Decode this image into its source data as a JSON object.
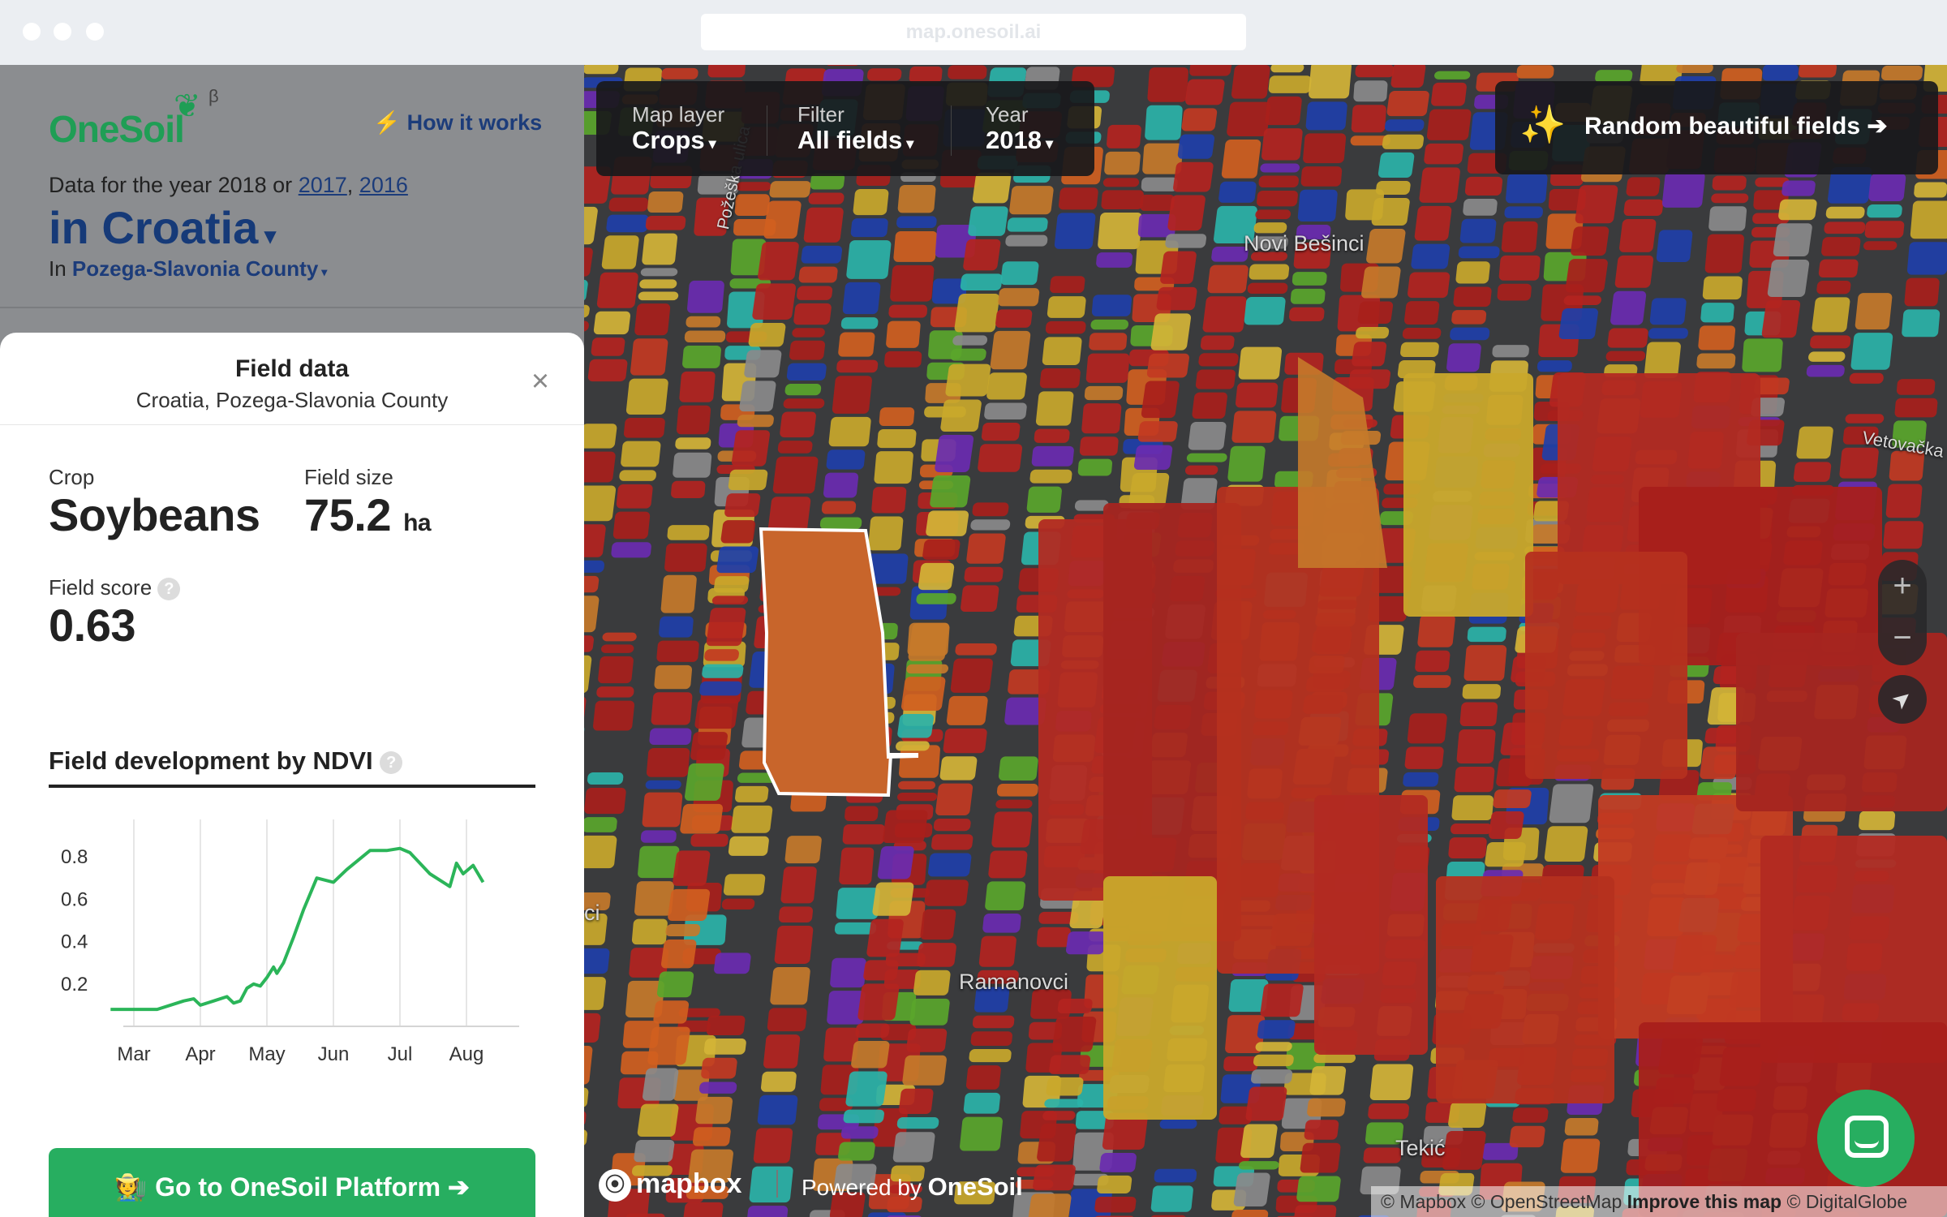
{
  "browser": {
    "url": "map.onesoil.ai"
  },
  "header": {
    "logo": "OneSoil",
    "beta": "β",
    "how_it_works": "How it works",
    "data_for_prefix": "Data for the year 2018 or",
    "other_years": [
      "2017",
      "2016"
    ],
    "country": "in Croatia",
    "region_prefix": "In",
    "region": "Pozega-Slavonia County"
  },
  "field_card": {
    "title": "Field data",
    "subtitle": "Croatia, Pozega-Slavonia County",
    "crop_label": "Crop",
    "crop_value": "Soybeans",
    "size_label": "Field size",
    "size_value": "75.2",
    "size_unit": "ha",
    "score_label": "Field score",
    "score_value": "0.63",
    "ndvi_title": "Field development by NDVI",
    "help_glyph": "?",
    "cta": "Go to OneSoil Platform ➔"
  },
  "chart_data": {
    "type": "line",
    "title": "Field development by NDVI",
    "xlabel": "",
    "ylabel": "",
    "x_tick_labels": [
      "Mar",
      "Apr",
      "May",
      "Jun",
      "Jul",
      "Aug"
    ],
    "y_tick_labels": [
      "0.2",
      "0.6",
      "0.4",
      "0.8"
    ],
    "y_ticks": [
      0.2,
      0.4,
      0.6,
      0.8
    ],
    "ylim": [
      0,
      0.9
    ],
    "xlim": [
      0,
      6
    ],
    "grid": "vertical",
    "series": [
      {
        "color": "#2bb559",
        "x": [
          0,
          0.3,
          0.7,
          1.0,
          1.1,
          1.25,
          1.35,
          1.55,
          1.75,
          1.85,
          1.95,
          2.05,
          2.15,
          2.25,
          2.35,
          2.45,
          2.5,
          2.6,
          2.75,
          2.9,
          3.1,
          3.35,
          3.55,
          3.9,
          4.15,
          4.35,
          4.5,
          4.8,
          5.0,
          5.1,
          5.2,
          5.3,
          5.45,
          5.6
        ],
        "y": [
          0.08,
          0.08,
          0.08,
          0.11,
          0.12,
          0.13,
          0.1,
          0.12,
          0.14,
          0.11,
          0.12,
          0.18,
          0.2,
          0.19,
          0.23,
          0.28,
          0.25,
          0.3,
          0.42,
          0.55,
          0.7,
          0.68,
          0.74,
          0.83,
          0.83,
          0.84,
          0.82,
          0.72,
          0.68,
          0.66,
          0.77,
          0.72,
          0.76,
          0.68
        ]
      }
    ]
  },
  "map": {
    "layer_label": "Map layer",
    "layer_value": "Crops",
    "filter_label": "Filter",
    "filter_value": "All fields",
    "year_label": "Year",
    "year_value": "2018",
    "random_fields": "Random beautiful fields ➔",
    "places": [
      "Novi Bešinci",
      "Ramanovci",
      "Tekić",
      "Vetovačka",
      "Požeška ulica",
      "ci"
    ],
    "zoom_in": "+",
    "zoom_out": "−",
    "locate": "➤",
    "mapbox": "mapbox",
    "powered_by": "Powered by",
    "powered_brand": "OneSoil",
    "attribution_plain": "© Mapbox © OpenStreetMap",
    "attribution_improve": "Improve this map",
    "attribution_globe": "© DigitalGlobe",
    "palette": [
      "#b3241f",
      "#a81f1b",
      "#c23a22",
      "#c9a82b",
      "#d4b437",
      "#d06020",
      "#2bb3a8",
      "#1f3fa8",
      "#6a2bb0",
      "#5aa62b",
      "#8a8a8a",
      "#c57a2a"
    ],
    "selected_field_color": "#c8652b",
    "grayscale_color": "#5a5a5a"
  }
}
